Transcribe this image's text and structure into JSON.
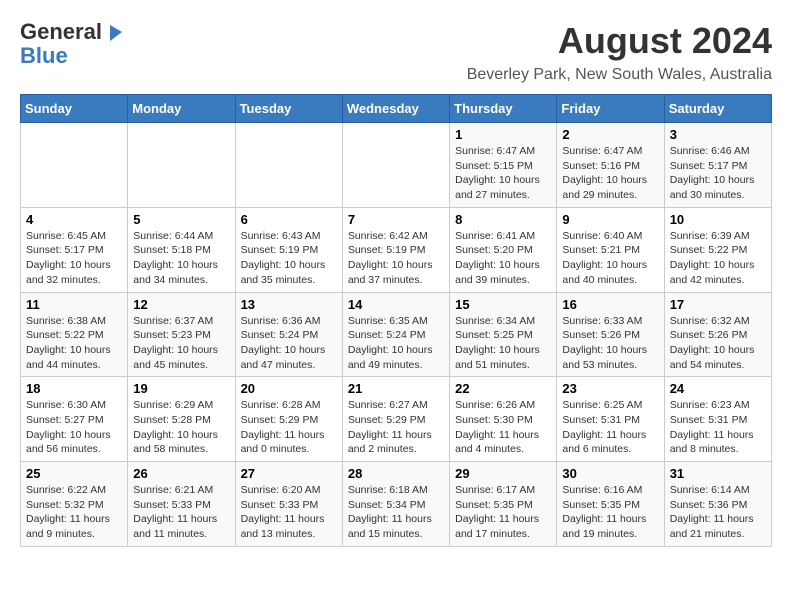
{
  "header": {
    "logo_general": "General",
    "logo_blue": "Blue",
    "main_title": "August 2024",
    "subtitle": "Beverley Park, New South Wales, Australia"
  },
  "calendar": {
    "days_of_week": [
      "Sunday",
      "Monday",
      "Tuesday",
      "Wednesday",
      "Thursday",
      "Friday",
      "Saturday"
    ],
    "weeks": [
      [
        {
          "day": "",
          "info": ""
        },
        {
          "day": "",
          "info": ""
        },
        {
          "day": "",
          "info": ""
        },
        {
          "day": "",
          "info": ""
        },
        {
          "day": "1",
          "info": "Sunrise: 6:47 AM\nSunset: 5:15 PM\nDaylight: 10 hours and 27 minutes."
        },
        {
          "day": "2",
          "info": "Sunrise: 6:47 AM\nSunset: 5:16 PM\nDaylight: 10 hours and 29 minutes."
        },
        {
          "day": "3",
          "info": "Sunrise: 6:46 AM\nSunset: 5:17 PM\nDaylight: 10 hours and 30 minutes."
        }
      ],
      [
        {
          "day": "4",
          "info": "Sunrise: 6:45 AM\nSunset: 5:17 PM\nDaylight: 10 hours and 32 minutes."
        },
        {
          "day": "5",
          "info": "Sunrise: 6:44 AM\nSunset: 5:18 PM\nDaylight: 10 hours and 34 minutes."
        },
        {
          "day": "6",
          "info": "Sunrise: 6:43 AM\nSunset: 5:19 PM\nDaylight: 10 hours and 35 minutes."
        },
        {
          "day": "7",
          "info": "Sunrise: 6:42 AM\nSunset: 5:19 PM\nDaylight: 10 hours and 37 minutes."
        },
        {
          "day": "8",
          "info": "Sunrise: 6:41 AM\nSunset: 5:20 PM\nDaylight: 10 hours and 39 minutes."
        },
        {
          "day": "9",
          "info": "Sunrise: 6:40 AM\nSunset: 5:21 PM\nDaylight: 10 hours and 40 minutes."
        },
        {
          "day": "10",
          "info": "Sunrise: 6:39 AM\nSunset: 5:22 PM\nDaylight: 10 hours and 42 minutes."
        }
      ],
      [
        {
          "day": "11",
          "info": "Sunrise: 6:38 AM\nSunset: 5:22 PM\nDaylight: 10 hours and 44 minutes."
        },
        {
          "day": "12",
          "info": "Sunrise: 6:37 AM\nSunset: 5:23 PM\nDaylight: 10 hours and 45 minutes."
        },
        {
          "day": "13",
          "info": "Sunrise: 6:36 AM\nSunset: 5:24 PM\nDaylight: 10 hours and 47 minutes."
        },
        {
          "day": "14",
          "info": "Sunrise: 6:35 AM\nSunset: 5:24 PM\nDaylight: 10 hours and 49 minutes."
        },
        {
          "day": "15",
          "info": "Sunrise: 6:34 AM\nSunset: 5:25 PM\nDaylight: 10 hours and 51 minutes."
        },
        {
          "day": "16",
          "info": "Sunrise: 6:33 AM\nSunset: 5:26 PM\nDaylight: 10 hours and 53 minutes."
        },
        {
          "day": "17",
          "info": "Sunrise: 6:32 AM\nSunset: 5:26 PM\nDaylight: 10 hours and 54 minutes."
        }
      ],
      [
        {
          "day": "18",
          "info": "Sunrise: 6:30 AM\nSunset: 5:27 PM\nDaylight: 10 hours and 56 minutes."
        },
        {
          "day": "19",
          "info": "Sunrise: 6:29 AM\nSunset: 5:28 PM\nDaylight: 10 hours and 58 minutes."
        },
        {
          "day": "20",
          "info": "Sunrise: 6:28 AM\nSunset: 5:29 PM\nDaylight: 11 hours and 0 minutes."
        },
        {
          "day": "21",
          "info": "Sunrise: 6:27 AM\nSunset: 5:29 PM\nDaylight: 11 hours and 2 minutes."
        },
        {
          "day": "22",
          "info": "Sunrise: 6:26 AM\nSunset: 5:30 PM\nDaylight: 11 hours and 4 minutes."
        },
        {
          "day": "23",
          "info": "Sunrise: 6:25 AM\nSunset: 5:31 PM\nDaylight: 11 hours and 6 minutes."
        },
        {
          "day": "24",
          "info": "Sunrise: 6:23 AM\nSunset: 5:31 PM\nDaylight: 11 hours and 8 minutes."
        }
      ],
      [
        {
          "day": "25",
          "info": "Sunrise: 6:22 AM\nSunset: 5:32 PM\nDaylight: 11 hours and 9 minutes."
        },
        {
          "day": "26",
          "info": "Sunrise: 6:21 AM\nSunset: 5:33 PM\nDaylight: 11 hours and 11 minutes."
        },
        {
          "day": "27",
          "info": "Sunrise: 6:20 AM\nSunset: 5:33 PM\nDaylight: 11 hours and 13 minutes."
        },
        {
          "day": "28",
          "info": "Sunrise: 6:18 AM\nSunset: 5:34 PM\nDaylight: 11 hours and 15 minutes."
        },
        {
          "day": "29",
          "info": "Sunrise: 6:17 AM\nSunset: 5:35 PM\nDaylight: 11 hours and 17 minutes."
        },
        {
          "day": "30",
          "info": "Sunrise: 6:16 AM\nSunset: 5:35 PM\nDaylight: 11 hours and 19 minutes."
        },
        {
          "day": "31",
          "info": "Sunrise: 6:14 AM\nSunset: 5:36 PM\nDaylight: 11 hours and 21 minutes."
        }
      ]
    ]
  }
}
